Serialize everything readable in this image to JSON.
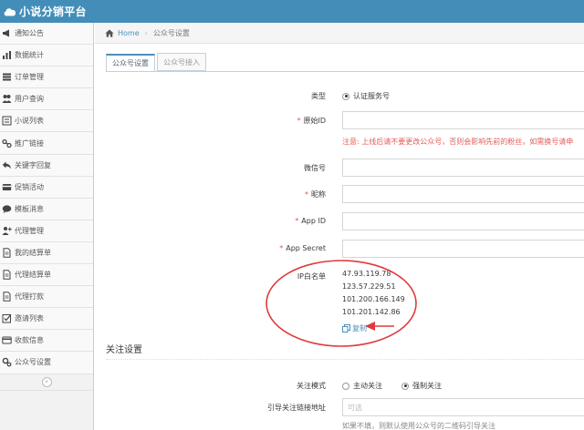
{
  "header": {
    "brand": "小说分销平台",
    "accent": "#438eb9"
  },
  "sidebar": {
    "items": [
      {
        "label": "通知公告",
        "icon": "bullhorn-icon"
      },
      {
        "label": "数据统计",
        "icon": "bar-chart-icon"
      },
      {
        "label": "订单管理",
        "icon": "list-icon"
      },
      {
        "label": "用户查询",
        "icon": "users-icon"
      },
      {
        "label": "小说列表",
        "icon": "book-list-icon"
      },
      {
        "label": "推广链接",
        "icon": "link-icon"
      },
      {
        "label": "关键字回复",
        "icon": "reply-icon"
      },
      {
        "label": "促销活动",
        "icon": "card-icon"
      },
      {
        "label": "模板消息",
        "icon": "message-icon"
      },
      {
        "label": "代理管理",
        "icon": "user-plus-icon"
      },
      {
        "label": "我的结算单",
        "icon": "file-icon"
      },
      {
        "label": "代理结算单",
        "icon": "file-icon"
      },
      {
        "label": "代理打款",
        "icon": "file-icon"
      },
      {
        "label": "邀请列表",
        "icon": "check-square-icon"
      },
      {
        "label": "收款信息",
        "icon": "credit-card-icon"
      },
      {
        "label": "公众号设置",
        "icon": "cogs-icon"
      }
    ],
    "collapse_icon": "double-angle-left-icon"
  },
  "breadcrumb": {
    "home": "Home",
    "current": "公众号设置"
  },
  "tabs": [
    {
      "label": "公众号设置",
      "active": true
    },
    {
      "label": "公众号接入",
      "active": false
    }
  ],
  "form": {
    "type_label": "类型",
    "type_value": "认证服务号",
    "original_id_label": "原始ID",
    "original_id_warning": "注意: 上线后请不要更改公众号，否则会影响先前的粉丝，如需换号请申",
    "wechat_label": "微信号",
    "nickname_label": "昵称",
    "appid_label": "App ID",
    "appsecret_label": "App Secret",
    "whitelist_label": "IP白名单",
    "ips": [
      "47.93.119.78",
      "123.57.229.51",
      "101.200.166.149",
      "101.201.142.86"
    ],
    "copy_label": "复制",
    "required_mark": "*"
  },
  "follow": {
    "section_title": "关注设置",
    "mode_label": "关注模式",
    "mode_options": [
      {
        "label": "主动关注",
        "selected": false
      },
      {
        "label": "强制关注",
        "selected": true
      }
    ],
    "guide_link_label": "引导关注链接地址",
    "guide_link_placeholder": "可选",
    "guide_hint": "如果不填，则默认使用公众号的二维码引导关注"
  },
  "annotation_color": "#e03a3a"
}
